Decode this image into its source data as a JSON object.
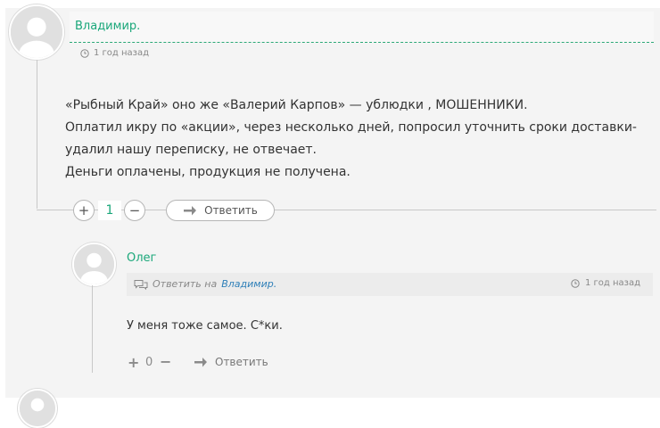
{
  "comment": {
    "author": "Владимир.",
    "time": "1 год назад",
    "body": [
      "«Рыбный Край» оно же «Валерий Карпов» — ублюдки , МОШЕННИКИ.",
      "Оплатил икру по «акции», через несколько дней, попросил уточнить сроки доставки-",
      "удалил нашу переписку, не отвечает.",
      "Деньги оплачены, продукция не получена."
    ],
    "vote_up": "+",
    "vote_down": "−",
    "votes": "1",
    "reply_label": "Ответить"
  },
  "reply": {
    "author": "Олег",
    "reply_to_prefix": "Ответить на",
    "reply_to_name": "Владимир.",
    "time": "1 год назад",
    "body": "У меня тоже самое. С*ки.",
    "vote_up": "+",
    "vote_down": "−",
    "votes": "0",
    "reply_label": "Ответить"
  },
  "colors": {
    "accent": "#1aa77a",
    "link": "#2e7fb8",
    "background": "#f4f4f4"
  },
  "icons": [
    "user-avatar-icon",
    "clock-icon",
    "reply-arrow-icon",
    "comments-icon",
    "plus-icon",
    "minus-icon"
  ]
}
